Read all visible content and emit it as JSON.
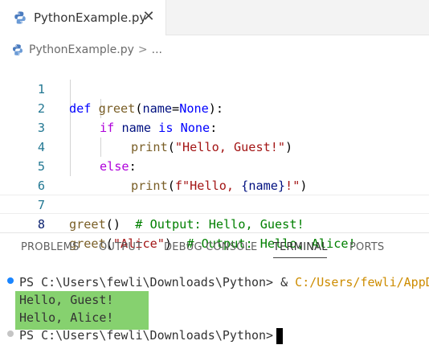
{
  "tab": {
    "filename": "PythonExample.py",
    "close": "✕"
  },
  "breadcrumb": {
    "file": "PythonExample.py",
    "chevron": ">",
    "ellipsis": "..."
  },
  "editor": {
    "lines": [
      {
        "n": "1"
      },
      {
        "n": "2"
      },
      {
        "n": "3"
      },
      {
        "n": "4"
      },
      {
        "n": "5"
      },
      {
        "n": "6"
      },
      {
        "n": "7"
      },
      {
        "n": "8"
      }
    ],
    "current_line": 8,
    "tokens": {
      "l1": [
        "def",
        " ",
        "greet",
        "(",
        "name",
        "=",
        "None",
        "):"
      ],
      "l2": [
        "if",
        " name ",
        "is",
        " ",
        "None",
        ":"
      ],
      "l3": [
        "print",
        "(",
        "\"Hello, Guest!\"",
        ")"
      ],
      "l4": [
        "else",
        ":"
      ],
      "l5": [
        "print",
        "(",
        "f\"Hello, ",
        "{name}",
        "!\"",
        ")"
      ],
      "l7": [
        "greet",
        "()",
        "  # Output: Hello, Guest!"
      ],
      "l8": [
        "greet",
        "(",
        "\"Alice\"",
        ")",
        "  # Output: Hello, Alice!"
      ]
    }
  },
  "panel": {
    "tabs": [
      "PROBLEMS",
      "OUTPUT",
      "DEBUG CONSOLE",
      "TERMINAL",
      "PORTS"
    ],
    "active_tab": "TERMINAL"
  },
  "terminal": {
    "prompt1": "PS C:\\Users\\fewli\\Downloads\\Python>",
    "cmd_amp": " & ",
    "cmd_path": "C:/Users/fewli/AppD",
    "out1": "Hello, Guest!",
    "out2": "Hello, Alice!",
    "prompt2": "PS C:\\Users\\fewli\\Downloads\\Python>"
  },
  "colors": {
    "keyword": "#0000ff",
    "control": "#af00db",
    "function": "#795e26",
    "string": "#a31515",
    "comment": "#008000",
    "highlight": "#86d16f",
    "line_number": "#237893"
  },
  "icons": {
    "file": "python-icon",
    "close": "close-icon"
  }
}
